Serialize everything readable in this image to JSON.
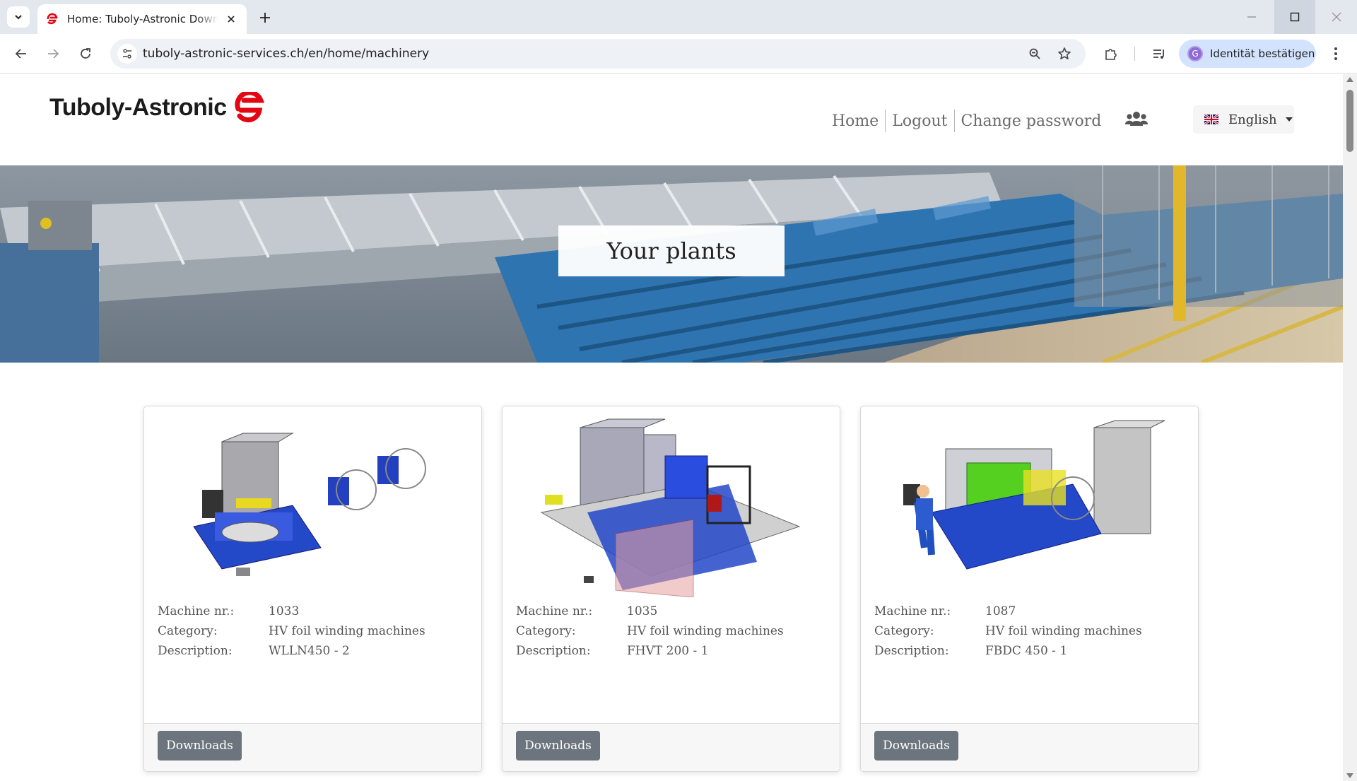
{
  "browser": {
    "tab_title": "Home: Tuboly-Astronic Downloads",
    "url": "tuboly-astronic-services.ch/en/home/machinery",
    "profile_initial": "G",
    "profile_label": "Identität bestätigen",
    "icons": [
      "tab-list-icon",
      "close-icon",
      "plus-icon",
      "minimize-icon",
      "maximize-icon",
      "back-icon",
      "forward-icon",
      "reload-icon",
      "site-info-icon",
      "zoom-icon",
      "star-icon",
      "extensions-icon",
      "media-icon",
      "more-icon"
    ]
  },
  "site": {
    "logo_text": "Tuboly-Astronic",
    "brand_color": "#e30613",
    "nav": {
      "home": "Home",
      "logout": "Logout",
      "change_password": "Change password"
    },
    "language": "English"
  },
  "hero": {
    "title": "Your plants"
  },
  "labels": {
    "machine_nr": "Machine nr.:",
    "category": "Category:",
    "description": "Description:",
    "downloads": "Downloads"
  },
  "machines": [
    {
      "number": "1033",
      "category": "HV foil winding machines",
      "description": "WLLN450 - 2"
    },
    {
      "number": "1035",
      "category": "HV foil winding machines",
      "description": "FHVT 200 - 1"
    },
    {
      "number": "1087",
      "category": "HV foil winding machines",
      "description": "FBDC 450 - 1"
    }
  ]
}
